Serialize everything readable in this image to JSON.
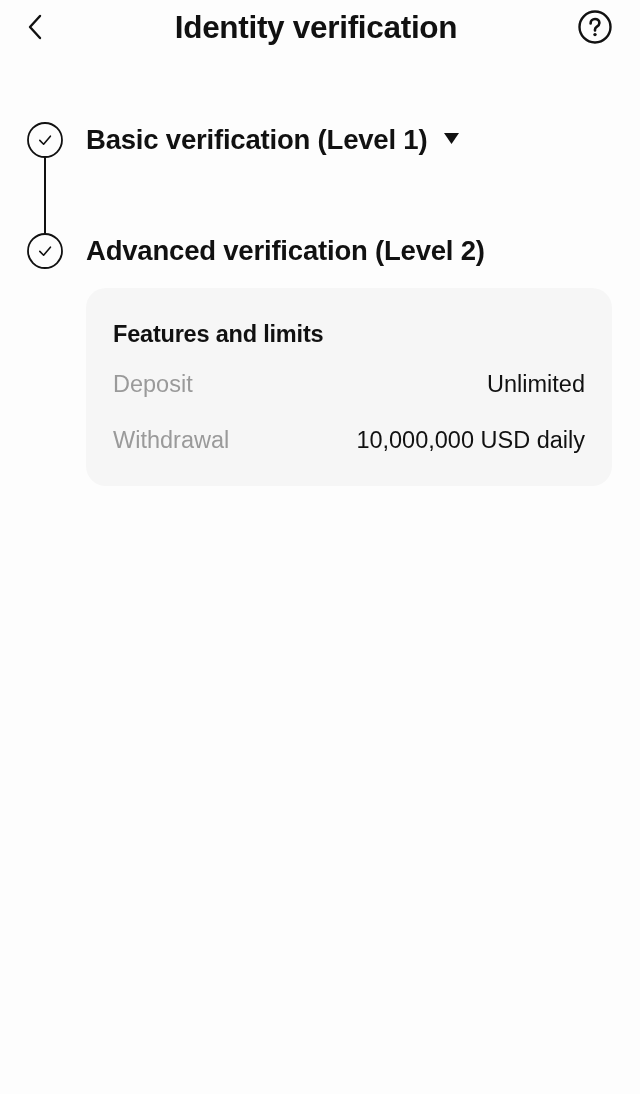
{
  "header": {
    "title": "Identity verification"
  },
  "steps": [
    {
      "title": "Basic verification (Level 1)",
      "completed": true,
      "expanded": false
    },
    {
      "title": "Advanced verification (Level 2)",
      "completed": true,
      "expanded": true,
      "details": {
        "heading": "Features and limits",
        "rows": [
          {
            "label": "Deposit",
            "value": "Unlimited"
          },
          {
            "label": "Withdrawal",
            "value": "10,000,000 USD daily"
          }
        ]
      }
    }
  ]
}
